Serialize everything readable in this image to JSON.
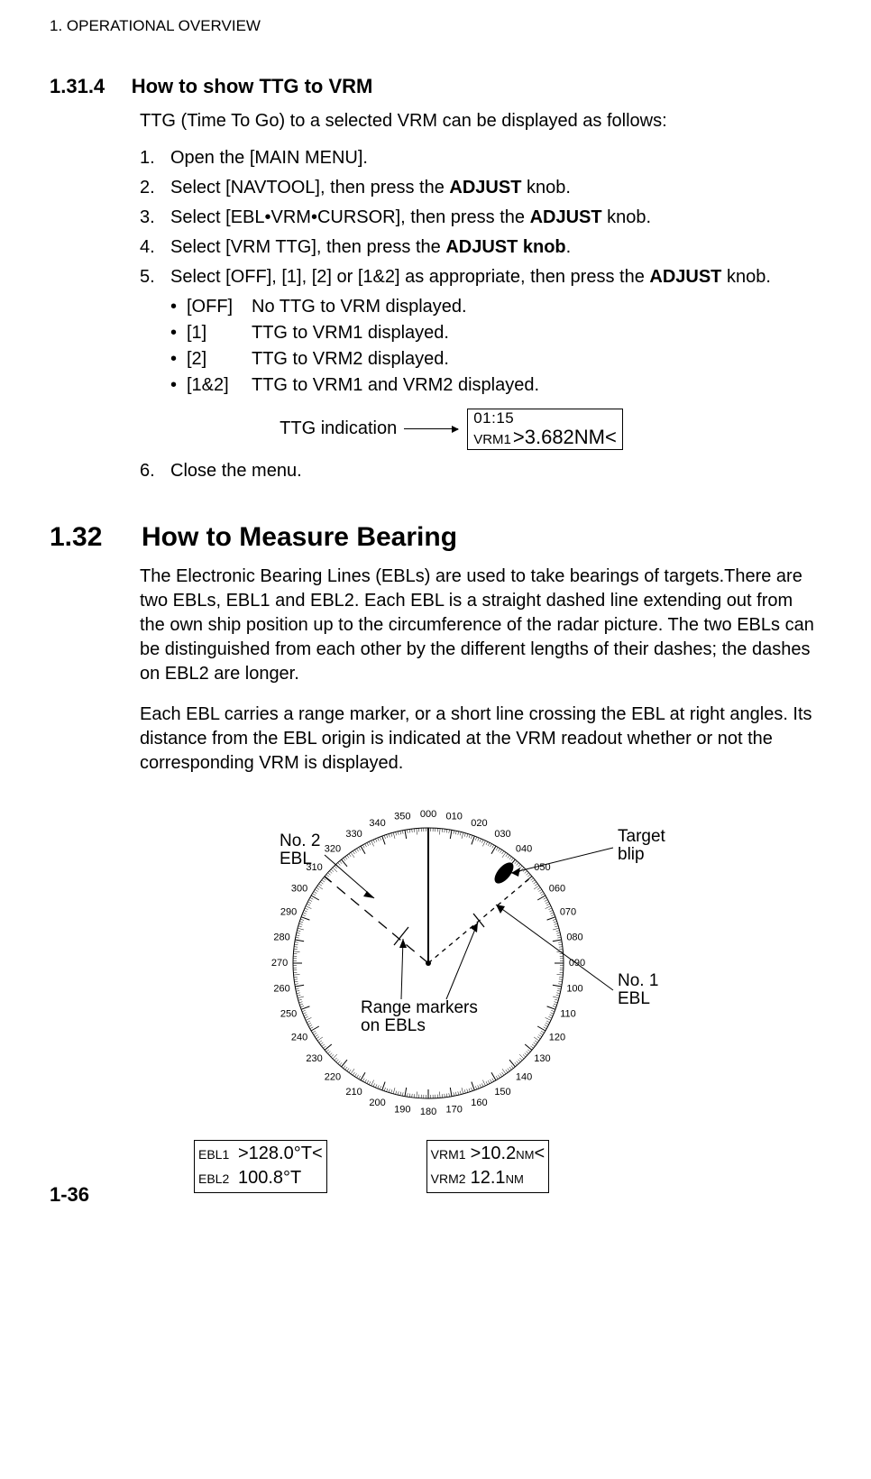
{
  "chapter_header": "1.  OPERATIONAL OVERVIEW",
  "section1": {
    "num": "1.31.4",
    "title": "How to show TTG to VRM",
    "intro": "TTG (Time To Go) to a selected VRM can be displayed as follows:",
    "steps": {
      "s1_num": "1.",
      "s1_txt": "Open the [MAIN MENU].",
      "s2_num": "2.",
      "s2_pre": "Select [NAVTOOL], then press the ",
      "s2_bold": "ADJUST",
      "s2_post": " knob.",
      "s3_num": "3.",
      "s3_pre": "Select [EBL•VRM•CURSOR], then press the ",
      "s3_bold": "ADJUST",
      "s3_post": " knob.",
      "s4_num": "4.",
      "s4_pre": "Select [VRM TTG], then press the ",
      "s4_bold": "ADJUST knob",
      "s4_post": ".",
      "s5_num": "5.",
      "s5_pre": "Select [OFF], [1], [2] or [1&2] as appropriate, then press the ",
      "s5_bold": "ADJUST",
      "s5_post": " knob.",
      "s6_num": "6.",
      "s6_txt": "Close the menu."
    },
    "options": {
      "o1_opt": "[OFF]",
      "o1_txt": "No TTG to VRM displayed.",
      "o2_opt": "[1]",
      "o2_txt": "TTG to VRM1 displayed.",
      "o3_opt": "[2]",
      "o3_txt": "TTG to VRM2 displayed.",
      "o4_opt": "[1&2]",
      "o4_txt": "TTG to VRM1 and VRM2 displayed."
    },
    "ttg_indication_label": "TTG indication",
    "ttg_box_top": "01:15",
    "ttg_box_bot_label": "VRM1",
    "ttg_box_bot_value": ">3.682NM<"
  },
  "section2": {
    "num": "1.32",
    "title": "How to Measure Bearing",
    "para1": "The Electronic Bearing Lines (EBLs) are used to take bearings of targets.There are two EBLs, EBL1 and EBL2. Each EBL is a straight dashed line extending out from the own ship position up to the circumference of the radar picture. The two EBLs can be distinguished from each other by the different lengths of their dashes; the dashes on EBL2 are longer.",
    "para2": "Each EBL carries a range marker, or a short line crossing the EBL at right angles. Its distance from the EBL origin is indicated at the VRM readout whether or not the corresponding VRM is displayed."
  },
  "figure": {
    "labels": {
      "no2_ebl_l1": "No. 2",
      "no2_ebl_l2": "EBL",
      "target_l1": "Target",
      "target_l2": "blip",
      "no1_ebl_l1": "No. 1",
      "no1_ebl_l2": "EBL",
      "range_l1": "Range markers",
      "range_l2": "on EBLs"
    },
    "readouts": {
      "ebl1_lbl": "EBL1",
      "ebl1_val": ">128.0°T<",
      "ebl2_lbl": "EBL2",
      "ebl2_val": " 100.8°T",
      "vrm1_lbl": "VRM1",
      "vrm1_val": ">10.2",
      "vrm1_unit": "NM",
      "vrm1_close": "<",
      "vrm2_lbl": "VRM2",
      "vrm2_val": "  12.1",
      "vrm2_unit": "NM"
    }
  },
  "page_number": "1-36"
}
